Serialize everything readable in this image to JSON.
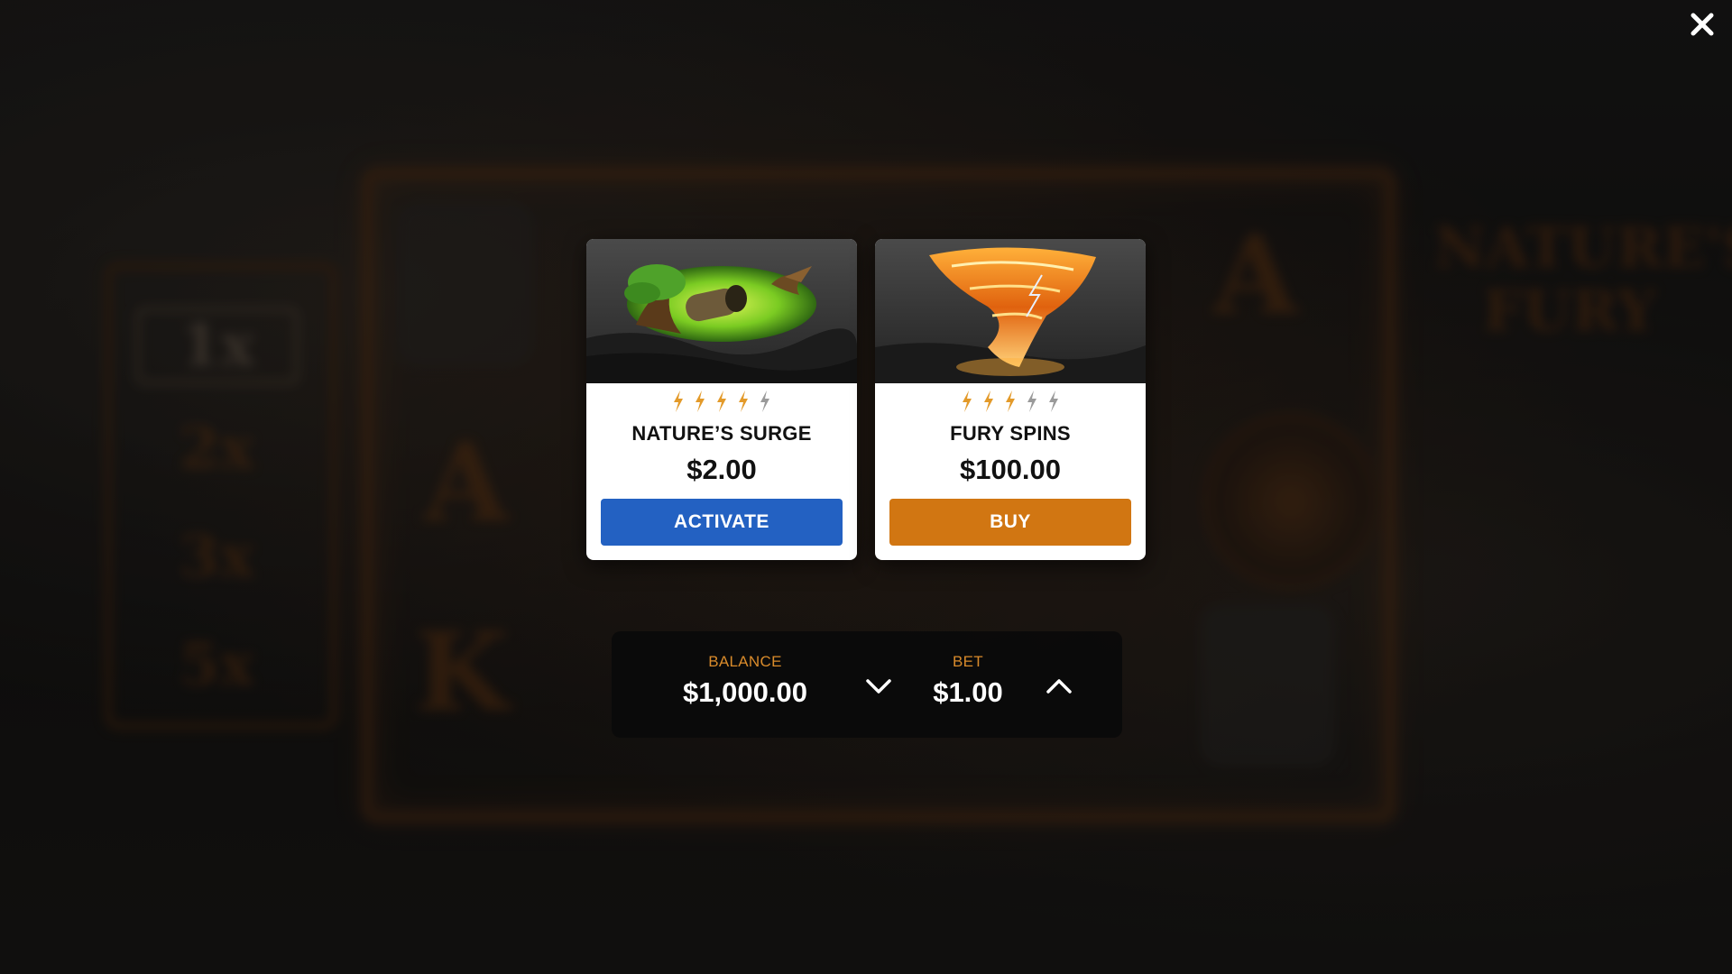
{
  "background": {
    "multipliers": [
      "1x",
      "2x",
      "3x",
      "5x"
    ],
    "symbols": [
      "A",
      "A",
      "K",
      "A"
    ],
    "logo_text": "NATURE'S FURY"
  },
  "close_button": {
    "icon": "close-icon",
    "color": "#ffffff"
  },
  "cards": [
    {
      "title": "NATURE’S SURGE",
      "price": "$2.00",
      "button_label": "ACTIVATE",
      "button_color": "#2361c2",
      "rating": {
        "filled": 4,
        "total": 5,
        "icon": "lightning-bolt-icon"
      },
      "image": "tree-cannon-bird-illustration"
    },
    {
      "title": "FURY SPINS",
      "price": "$100.00",
      "button_label": "BUY",
      "button_color": "#d17612",
      "rating": {
        "filled": 3,
        "total": 5,
        "icon": "lightning-bolt-icon"
      },
      "image": "fire-tornado-illustration"
    }
  ],
  "wallet": {
    "balance_label": "BALANCE",
    "balance_value": "$1,000.00",
    "bet_label": "BET",
    "bet_value": "$1.00",
    "decrease_icon": "chevron-down-icon",
    "increase_icon": "chevron-up-icon"
  },
  "colors": {
    "accent_orange": "#d98b2b",
    "bolt_filled": "#e39a2a",
    "bolt_empty": "#9a9a9a"
  }
}
